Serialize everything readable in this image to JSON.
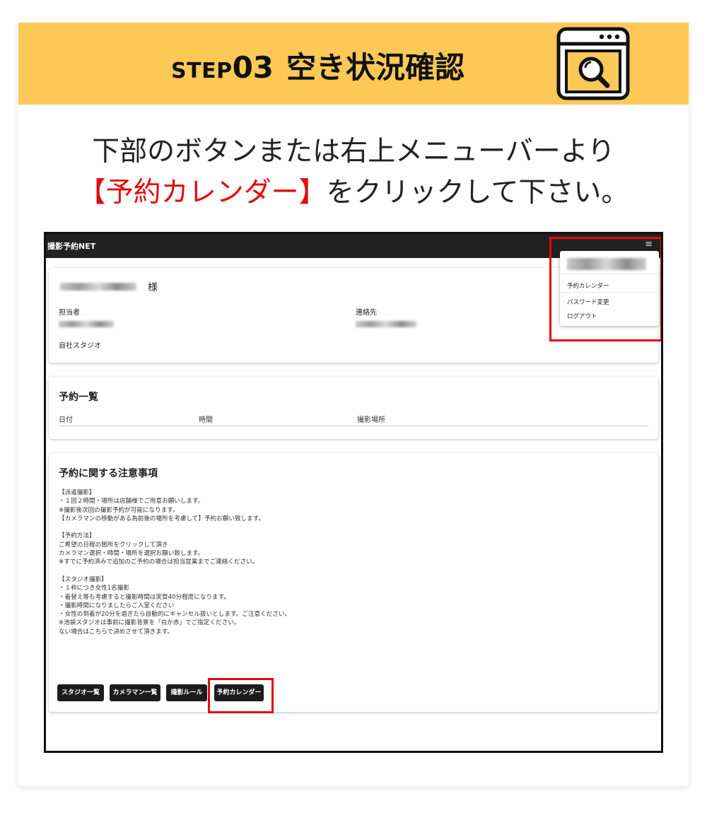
{
  "header": {
    "step_word": "STEP",
    "step_number": "03",
    "title": "空き状況確認",
    "icon": "browser-search-icon",
    "bg_color": "#fcc956"
  },
  "instruction": {
    "line1": "下部のボタンまたは右上メニューバーより",
    "line2_highlight": "【予約カレンダー】",
    "line2_rest": "をクリックして下さい。",
    "highlight_color": "#e30b0b"
  },
  "screenshot": {
    "navbar": {
      "brand": "撮影予約NET",
      "menu_icon": "hamburger-icon"
    },
    "dropdown_menu": {
      "items": [
        "予約カレンダー",
        "パスワード変更",
        "ログアウト"
      ]
    },
    "customer": {
      "suffix": "様",
      "staff_label": "担当者",
      "contact_label": "連絡先",
      "studio": "自社スタジオ"
    },
    "reservations": {
      "title": "予約一覧",
      "columns": [
        "日付",
        "時間",
        "撮影場所"
      ]
    },
    "notes": {
      "title": "予約に関する注意事項",
      "body": "【派遣撮影】\n・１回２時間・場所は店舗様でご用意お願いします。\n※撮影後次回の撮影予約が可能になります。\n【カメラマンの移動がある為前後の場所を考慮して】予約お願い致します。\n\n【予約方法】\nご希望の日程の箇所をクリックして頂き\nカメラマン選択・時間・場所を選択お願い致します。\n※すでに予約済みで追加のご予約の場合は担当営業までご連絡ください。\n\n【スタジオ撮影】\n・１枠につき女性1名撮影\n・着替え等も考慮すると撮影時間は実質40分程度になります。\n・撮影時間になりましたらご入室ください\n・女性の到着が20分を過ぎたら自動的にキャンセル扱いとします。ご注意ください。\n※池袋スタジオは事前に撮影背景を「白か赤」でご指定ください。\nない場合はこちらで決めさせて頂きます。"
    },
    "buttons": [
      "スタジオ一覧",
      "カメラマン一覧",
      "撮影ルール",
      "予約カレンダー"
    ]
  }
}
